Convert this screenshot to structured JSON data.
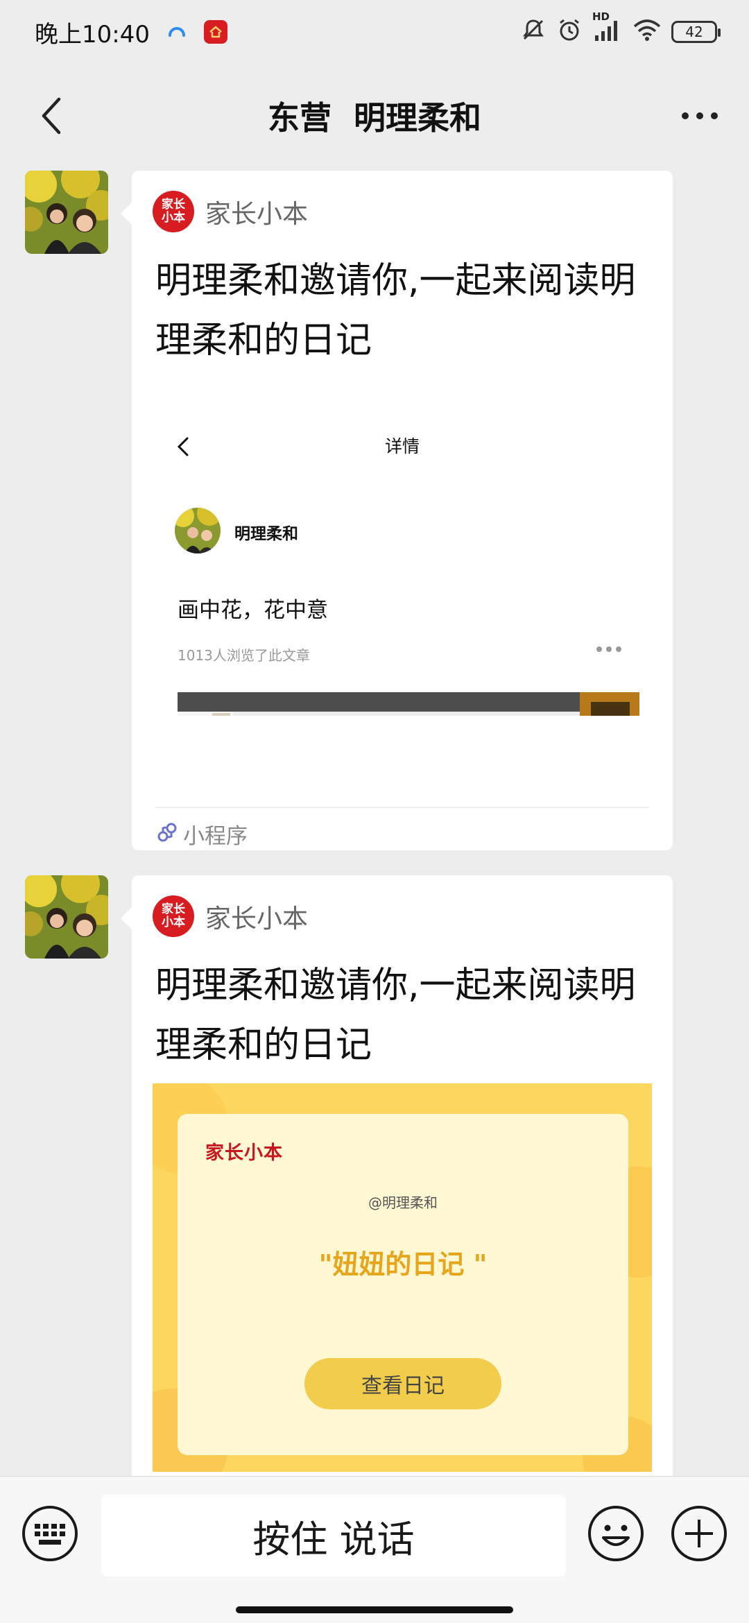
{
  "status_bar": {
    "time": "晚上10:40",
    "network": "HD",
    "battery": "42"
  },
  "header": {
    "title": "东营  明理柔和"
  },
  "messages": [
    {
      "app_name": "家长小本",
      "app_logo_text": "家长\n小本",
      "title": "明理柔和邀请你,一起来阅读明理柔和的日记",
      "preview": {
        "page_title": "详情",
        "author": "明理柔和",
        "heading": "画中花，花中意",
        "views": "1013人浏览了此文章"
      },
      "footer_label": "小程序"
    },
    {
      "app_name": "家长小本",
      "app_logo_text": "家长\n小本",
      "title": "明理柔和邀请你,一起来阅读明理柔和的日记",
      "preview": {
        "brand": "家长小本",
        "author_handle": "@明理柔和",
        "diary_title": "\"妞妞的日记 \"",
        "button_label": "查看日记"
      }
    }
  ],
  "input_bar": {
    "voice_label": "按住 说话"
  },
  "colors": {
    "background": "#ededed",
    "brand_red": "#d71d21",
    "card_yellow": "#fdd660",
    "diary_title": "#e6a51a"
  }
}
